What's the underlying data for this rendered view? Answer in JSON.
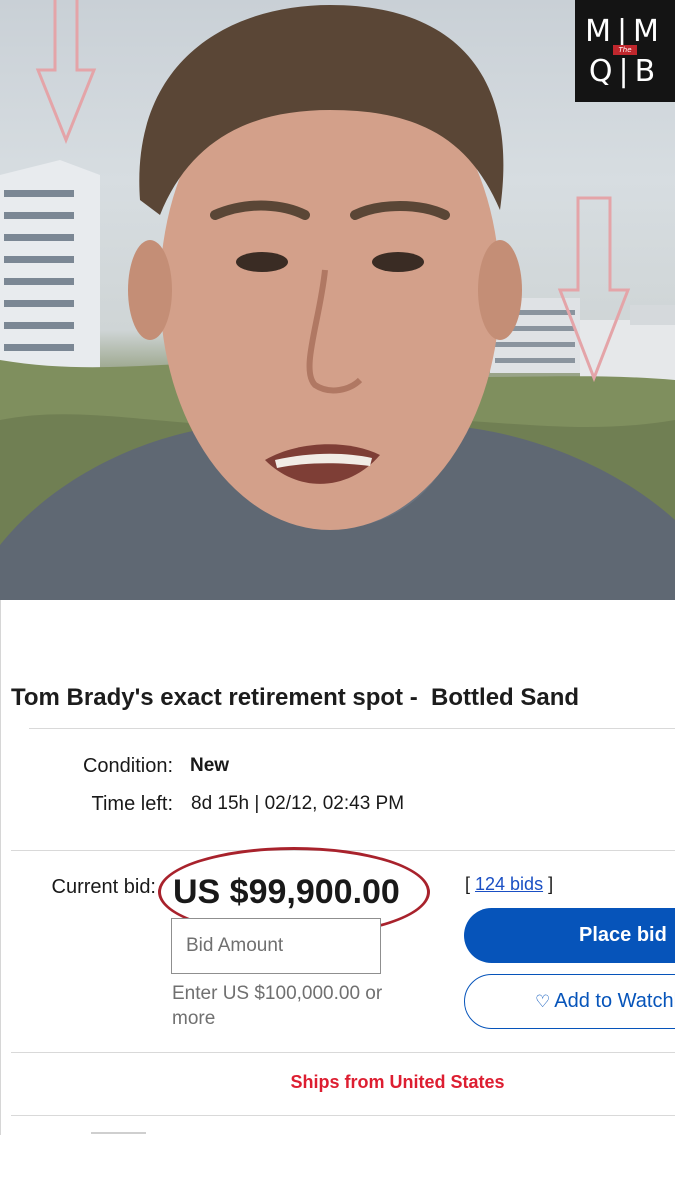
{
  "logo": {
    "row1": "M|M",
    "row2": "Q|B",
    "badge": "The"
  },
  "listing": {
    "title": "Tom Brady's exact retirement spot -  Bottled Sand",
    "condition_label": "Condition:",
    "condition_value": "New",
    "time_left_label": "Time left:",
    "time_left_value": "8d 15h | 02/12, 02:43 PM",
    "current_bid_label": "Current bid:",
    "current_bid_value": "US $99,900.00",
    "bids_open": "[ ",
    "bids_link": "124 bids",
    "bids_close": " ]",
    "bid_placeholder": "Bid Amount",
    "bid_hint": "Enter US $100,000.00 or more",
    "place_bid_label": "Place bid",
    "watch_label": "Add to Watchlist",
    "ships_from": "Ships from United States"
  },
  "colors": {
    "primary_blue": "#0654ba",
    "link_blue": "#1a4fc4",
    "ships_red": "#dd1e31",
    "highlight_ring": "#a8222c"
  },
  "icons": [
    "heart-icon",
    "down-arrow-icon"
  ]
}
